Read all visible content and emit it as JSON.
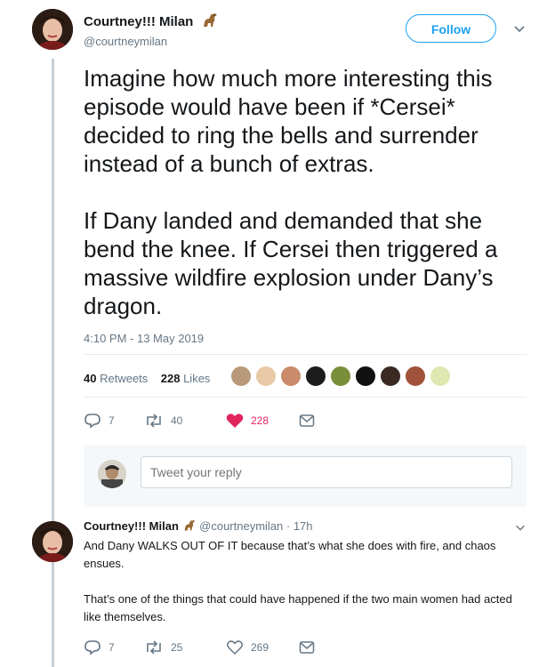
{
  "tweet": {
    "author_name": "Courtney!!! Milan",
    "handle": "@courtneymilan",
    "follow_label": "Follow",
    "paragraphs": [
      "Imagine how much more interesting this episode would have been if *Cersei* decided to ring the bells and surrender instead of a bunch of extras.",
      "If Dany landed and demanded that she bend the knee. If Cersei then triggered a massive wildfire explosion under Dany’s dragon."
    ],
    "timestamp": "4:10 PM - 13 May 2019",
    "retweets_count": "40",
    "retweets_label": "Retweets",
    "likes_count": "228",
    "likes_label": "Likes",
    "actions": {
      "replies": "7",
      "retweets": "40",
      "likes": "228"
    },
    "colors": {
      "like_active": "#e0245e",
      "accent": "#1da1f2",
      "muted": "#657786"
    }
  },
  "reply_box": {
    "placeholder": "Tweet your reply"
  },
  "reply": {
    "author_name": "Courtney!!! Milan",
    "handle": "@courtneymilan",
    "time": "· 17h",
    "paragraphs": [
      "And Dany WALKS OUT OF IT because that’s what she does with fire, and chaos ensues.",
      "That’s one of the things that could have happened if the two main women had acted like themselves."
    ],
    "actions": {
      "replies": "7",
      "retweets": "25",
      "likes": "269"
    }
  },
  "icons": [
    "dinosaur-icon",
    "chevron-down-icon",
    "reply-icon",
    "retweet-icon",
    "heart-icon",
    "direct-message-icon"
  ]
}
